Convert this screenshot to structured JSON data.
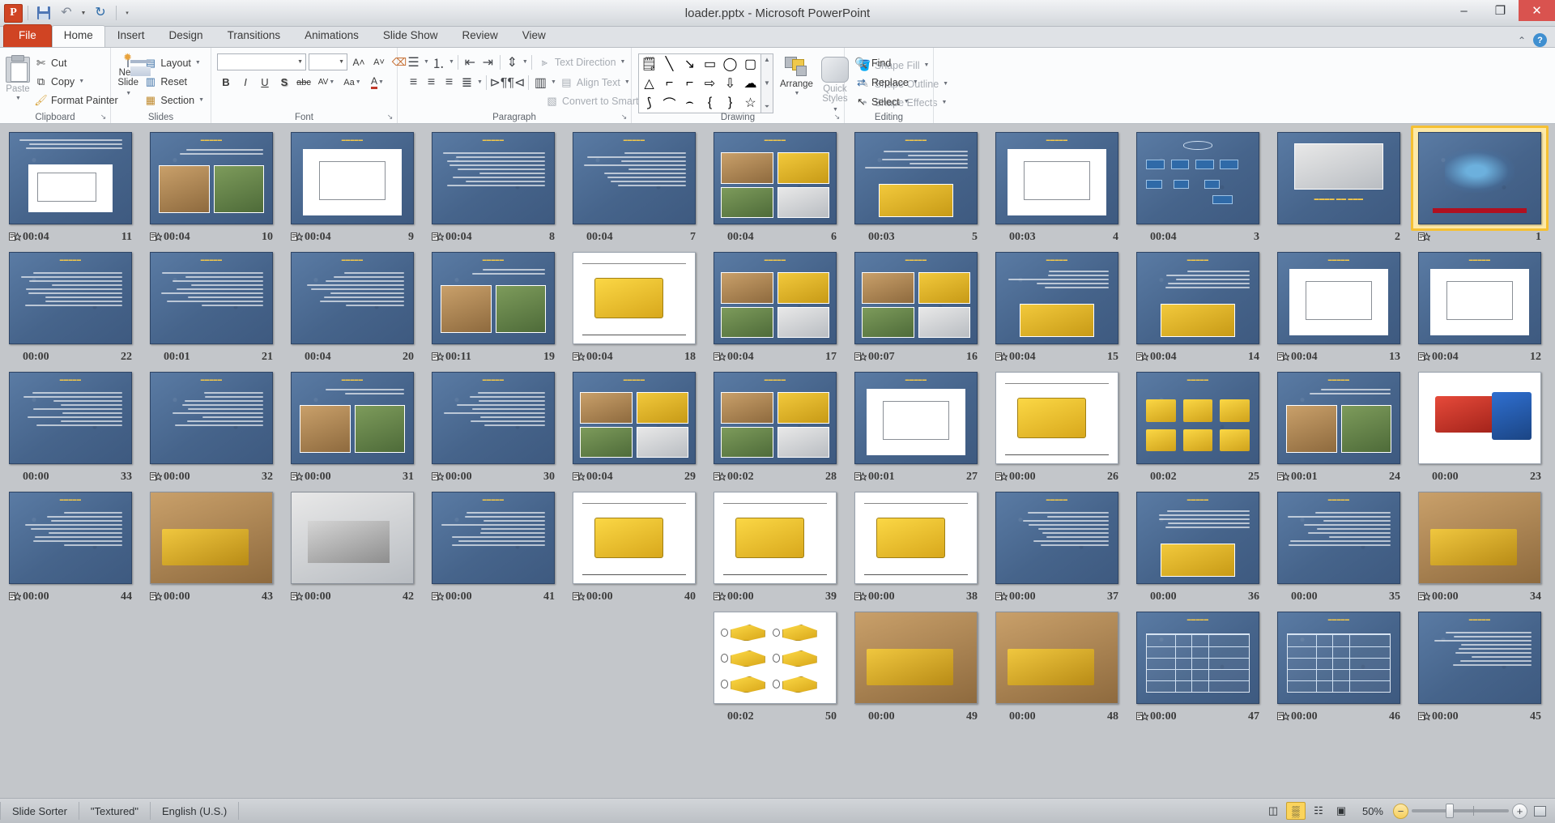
{
  "window": {
    "title": "loader.pptx  -  Microsoft PowerPoint",
    "minimize": "–",
    "restore": "❐",
    "close": "✕"
  },
  "quick_access": {
    "logo": "P",
    "save": "save-icon",
    "undo": "↶",
    "redo": "↻",
    "customize": "▾"
  },
  "tabs": [
    {
      "label": "File",
      "kind": "file"
    },
    {
      "label": "Home",
      "kind": "active"
    },
    {
      "label": "Insert",
      "kind": "normal"
    },
    {
      "label": "Design",
      "kind": "normal"
    },
    {
      "label": "Transitions",
      "kind": "normal"
    },
    {
      "label": "Animations",
      "kind": "normal"
    },
    {
      "label": "Slide Show",
      "kind": "normal"
    },
    {
      "label": "Review",
      "kind": "normal"
    },
    {
      "label": "View",
      "kind": "normal"
    }
  ],
  "tab_right": {
    "minimize_ribbon": "⌃",
    "help": "?"
  },
  "ribbon": {
    "clipboard": {
      "title": "Clipboard",
      "paste": "Paste",
      "cut": "Cut",
      "copy": "Copy",
      "format_painter": "Format Painter"
    },
    "slides": {
      "title": "Slides",
      "new_slide": "New\nSlide",
      "new_slide_line1": "New",
      "new_slide_line2": "Slide",
      "layout": "Layout",
      "reset": "Reset",
      "section": "Section"
    },
    "font": {
      "title": "Font",
      "font_name": "",
      "font_size": "",
      "grow": "A▴",
      "shrink": "A▾",
      "clear_formatting": "clear-formatting-icon",
      "bold": "B",
      "italic": "I",
      "underline": "U",
      "shadow": "S",
      "strikethrough": "abc",
      "character_spacing": "AV",
      "change_case": "Aa",
      "font_color": "A"
    },
    "paragraph": {
      "title": "Paragraph",
      "text_direction": "Text Direction",
      "align_text": "Align Text",
      "convert_to_smartart": "Convert to SmartArt"
    },
    "drawing": {
      "title": "Drawing",
      "arrange": "Arrange",
      "quick_styles_line1": "Quick",
      "quick_styles_line2": "Styles",
      "shape_fill": "Shape Fill",
      "shape_outline": "Shape Outline",
      "shape_effects": "Shape Effects"
    },
    "editing": {
      "title": "Editing",
      "find": "Find",
      "replace": "Replace",
      "select": "Select"
    }
  },
  "status_bar": {
    "view_name": "Slide Sorter",
    "theme": "\"Textured\"",
    "language": "English (U.S.)",
    "zoom_level": "50%",
    "views": [
      {
        "name": "normal-view-button",
        "glyph": "◫",
        "active": false
      },
      {
        "name": "slide-sorter-view-button",
        "glyph": "▒",
        "active": true
      },
      {
        "name": "reading-view-button",
        "glyph": "☷",
        "active": false
      },
      {
        "name": "slide-show-button",
        "glyph": "▣",
        "active": false
      }
    ],
    "zoom_out": "−",
    "zoom_in": "+",
    "fit_to_window": "fit-slide-to-window-icon"
  },
  "slides": [
    {
      "num": "11",
      "time": "00:04",
      "transition": true,
      "layout": "diagram"
    },
    {
      "num": "10",
      "time": "00:04",
      "transition": true,
      "layout": "two-photos"
    },
    {
      "num": "9",
      "time": "00:04",
      "transition": true,
      "layout": "sketch"
    },
    {
      "num": "8",
      "time": "00:04",
      "transition": true,
      "layout": "text"
    },
    {
      "num": "7",
      "time": "00:04",
      "transition": false,
      "layout": "text"
    },
    {
      "num": "6",
      "time": "00:04",
      "transition": false,
      "layout": "photo-collage"
    },
    {
      "num": "5",
      "time": "00:03",
      "transition": false,
      "layout": "text-photo"
    },
    {
      "num": "4",
      "time": "00:03",
      "transition": false,
      "layout": "sketch"
    },
    {
      "num": "3",
      "time": "00:04",
      "transition": false,
      "layout": "orgchart"
    },
    {
      "num": "2",
      "time": "",
      "transition": false,
      "layout": "title-photo"
    },
    {
      "num": "1",
      "time": "",
      "transition": true,
      "layout": "cover",
      "selected": true
    },
    {
      "num": "22",
      "time": "00:00",
      "transition": false,
      "layout": "text"
    },
    {
      "num": "21",
      "time": "00:01",
      "transition": false,
      "layout": "text"
    },
    {
      "num": "20",
      "time": "00:04",
      "transition": false,
      "layout": "text"
    },
    {
      "num": "19",
      "time": "00:11",
      "transition": true,
      "layout": "two-photos"
    },
    {
      "num": "18",
      "time": "00:04",
      "transition": true,
      "layout": "machine-dims"
    },
    {
      "num": "17",
      "time": "00:04",
      "transition": true,
      "layout": "photo-collage"
    },
    {
      "num": "16",
      "time": "00:07",
      "transition": true,
      "layout": "photo-collage"
    },
    {
      "num": "15",
      "time": "00:04",
      "transition": true,
      "layout": "text-photo"
    },
    {
      "num": "14",
      "time": "00:04",
      "transition": true,
      "layout": "text-photo"
    },
    {
      "num": "13",
      "time": "00:04",
      "transition": true,
      "layout": "sketch"
    },
    {
      "num": "12",
      "time": "00:04",
      "transition": true,
      "layout": "sketch"
    },
    {
      "num": "33",
      "time": "00:00",
      "transition": false,
      "layout": "text"
    },
    {
      "num": "32",
      "time": "00:00",
      "transition": true,
      "layout": "text"
    },
    {
      "num": "31",
      "time": "00:00",
      "transition": true,
      "layout": "two-photos"
    },
    {
      "num": "30",
      "time": "00:00",
      "transition": true,
      "layout": "text"
    },
    {
      "num": "29",
      "time": "00:04",
      "transition": true,
      "layout": "photo-collage"
    },
    {
      "num": "28",
      "time": "00:02",
      "transition": true,
      "layout": "photo-collage"
    },
    {
      "num": "27",
      "time": "00:01",
      "transition": true,
      "layout": "sketch"
    },
    {
      "num": "26",
      "time": "00:00",
      "transition": true,
      "layout": "machine-dims"
    },
    {
      "num": "25",
      "time": "00:02",
      "transition": false,
      "layout": "buckets"
    },
    {
      "num": "24",
      "time": "00:01",
      "transition": true,
      "layout": "two-photos"
    },
    {
      "num": "23",
      "time": "00:00",
      "transition": false,
      "layout": "tractor"
    },
    {
      "num": "44",
      "time": "00:00",
      "transition": true,
      "layout": "text"
    },
    {
      "num": "43",
      "time": "00:00",
      "transition": true,
      "layout": "photo-full"
    },
    {
      "num": "42",
      "time": "00:00",
      "transition": true,
      "layout": "photo-bw"
    },
    {
      "num": "41",
      "time": "00:00",
      "transition": true,
      "layout": "text"
    },
    {
      "num": "40",
      "time": "00:00",
      "transition": true,
      "layout": "machine-dims"
    },
    {
      "num": "39",
      "time": "00:00",
      "transition": true,
      "layout": "machine-dims"
    },
    {
      "num": "38",
      "time": "00:00",
      "transition": true,
      "layout": "machine-dims"
    },
    {
      "num": "37",
      "time": "00:00",
      "transition": true,
      "layout": "text"
    },
    {
      "num": "36",
      "time": "00:00",
      "transition": false,
      "layout": "text-photo"
    },
    {
      "num": "35",
      "time": "00:00",
      "transition": false,
      "layout": "text"
    },
    {
      "num": "34",
      "time": "00:00",
      "transition": true,
      "layout": "photo-full"
    },
    {
      "num": "50",
      "time": "00:02",
      "transition": false,
      "layout": "teeth"
    },
    {
      "num": "49",
      "time": "00:00",
      "transition": false,
      "layout": "photo-full"
    },
    {
      "num": "48",
      "time": "00:00",
      "transition": false,
      "layout": "photo-full"
    },
    {
      "num": "47",
      "time": "00:00",
      "transition": true,
      "layout": "table"
    },
    {
      "num": "46",
      "time": "00:00",
      "transition": true,
      "layout": "table"
    },
    {
      "num": "45",
      "time": "00:00",
      "transition": true,
      "layout": "text"
    }
  ],
  "rows": [
    {
      "start": 0,
      "count": 11,
      "offset": 0
    },
    {
      "start": 11,
      "count": 11,
      "offset": 0
    },
    {
      "start": 22,
      "count": 11,
      "offset": 0
    },
    {
      "start": 33,
      "count": 11,
      "offset": 0
    },
    {
      "start": 44,
      "count": 6,
      "offset": 5
    }
  ],
  "colors": {
    "accent_orange": "#d04423",
    "selection_yellow": "#f5c033",
    "slide_blue": "#46648b",
    "chrome_gray": "#c3c6ca"
  }
}
